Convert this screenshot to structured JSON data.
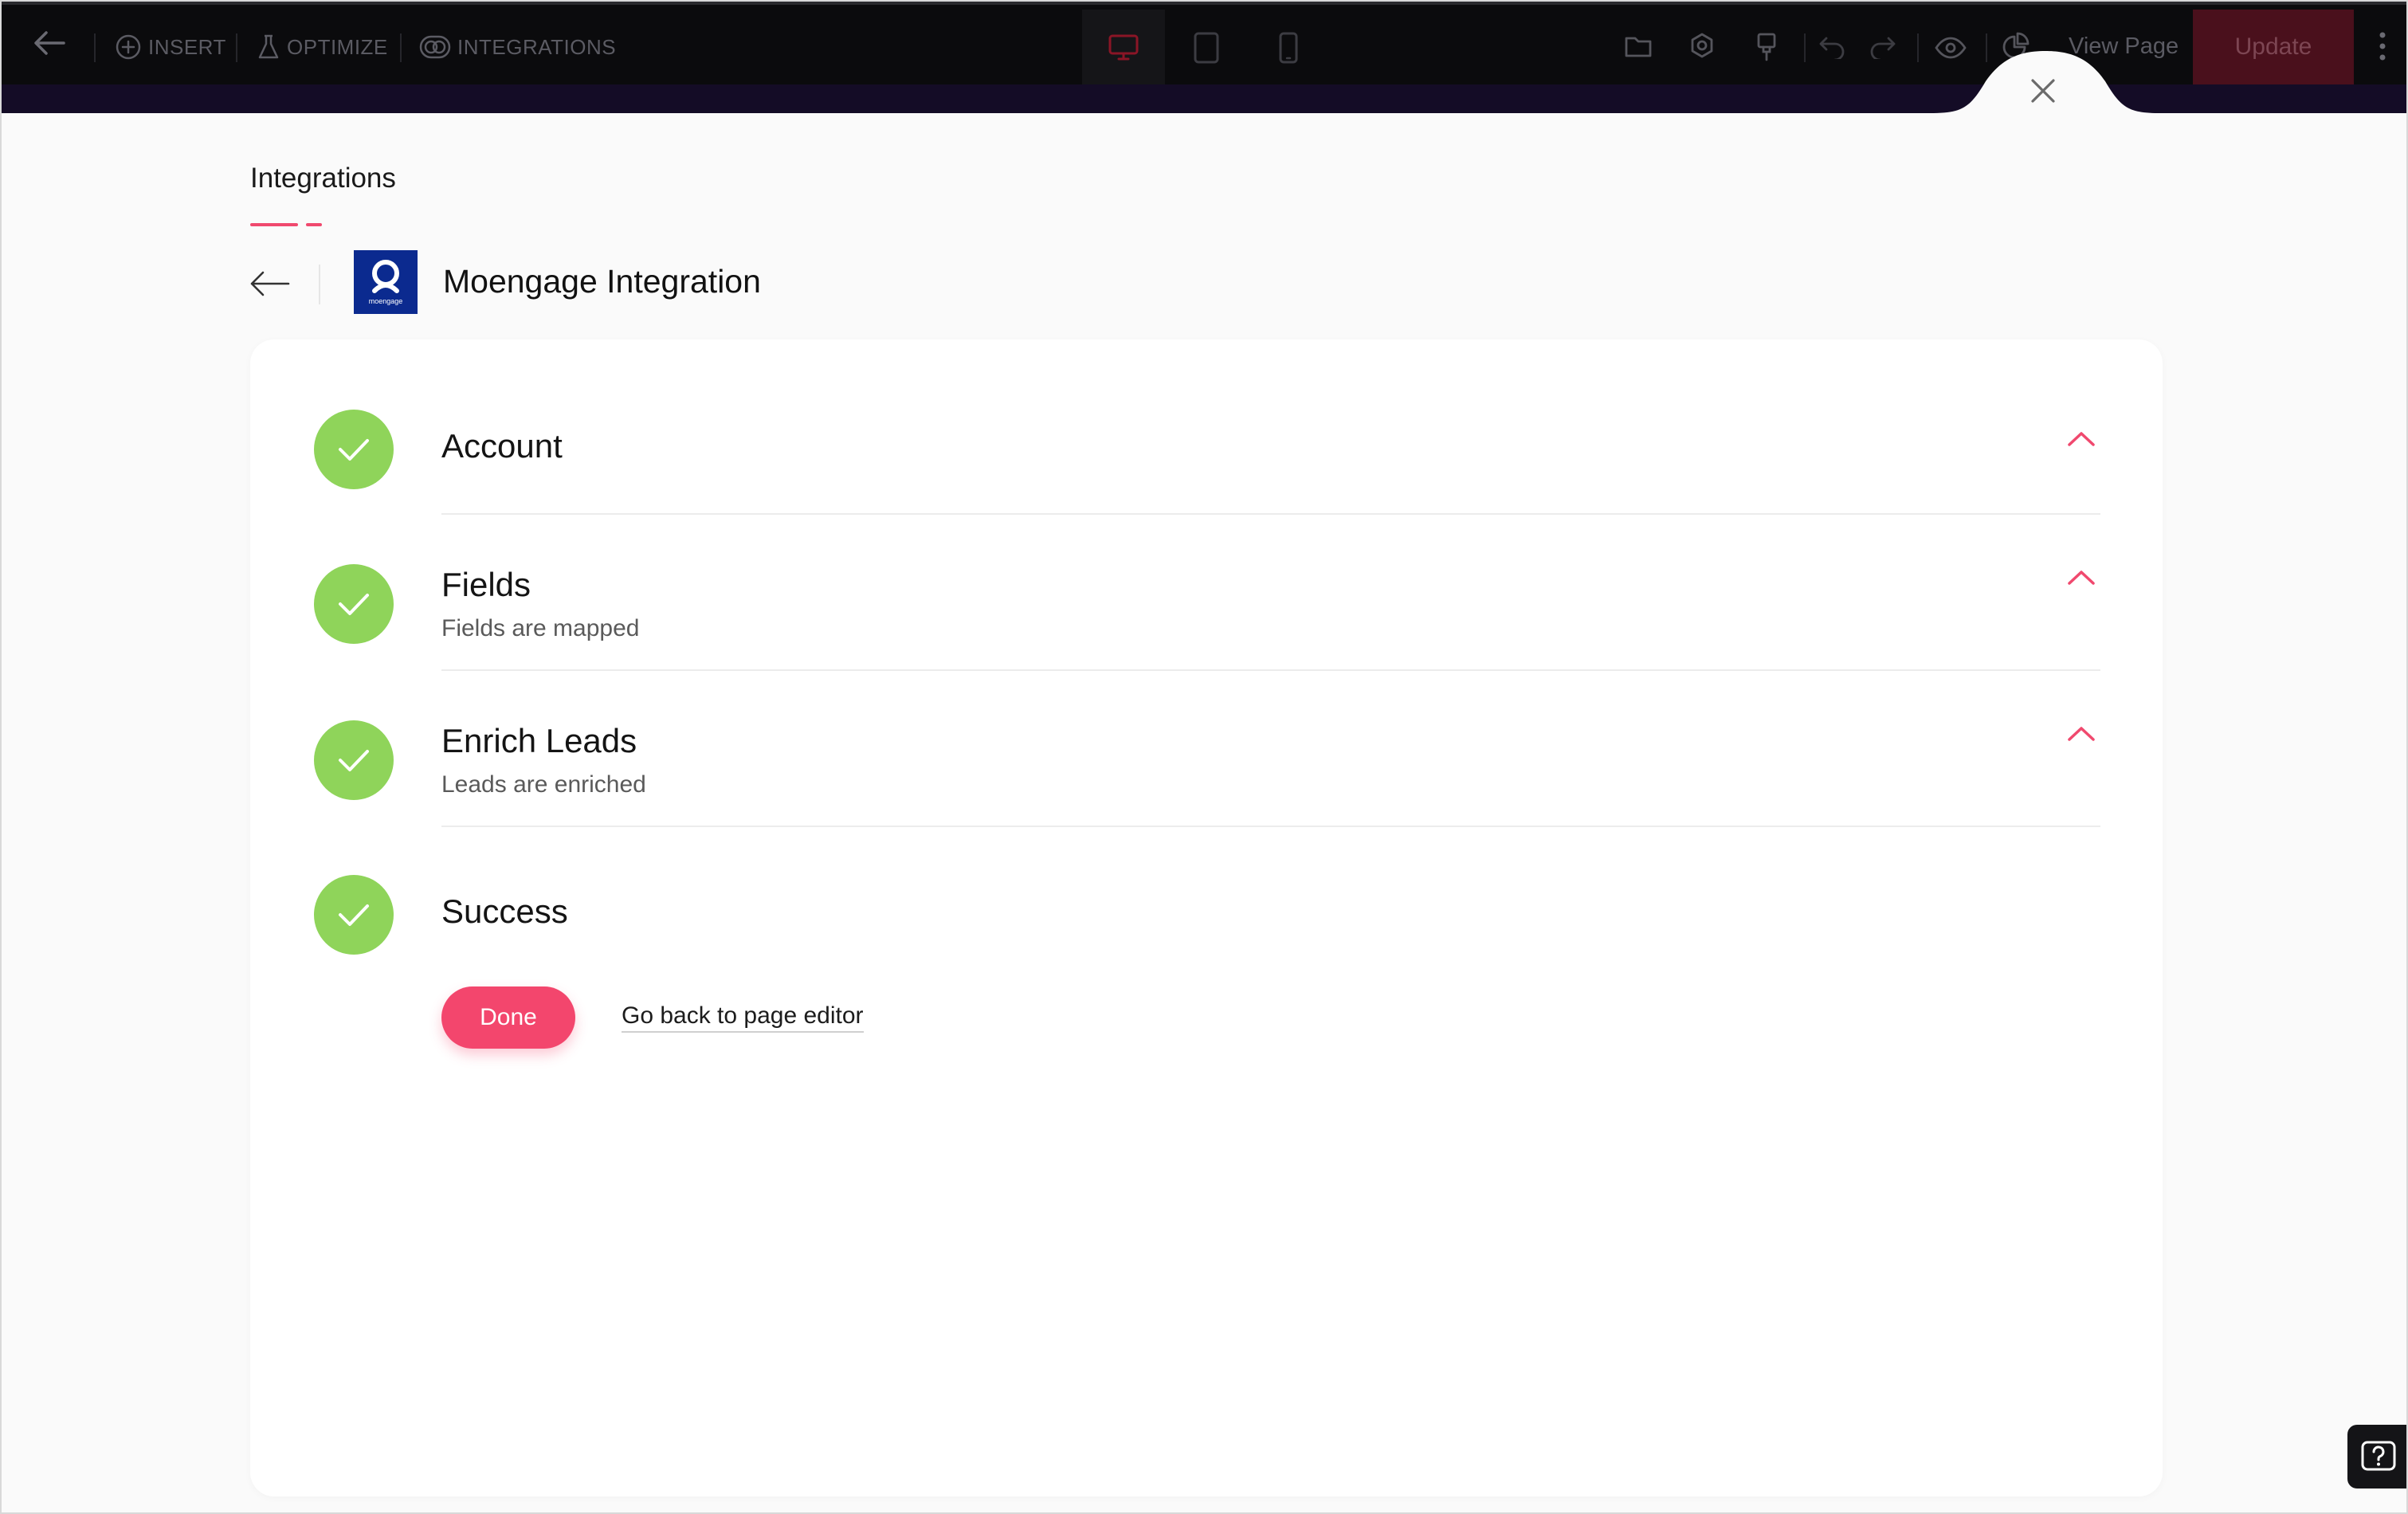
{
  "toolbar": {
    "insert_label": "INSERT",
    "optimize_label": "OPTIMIZE",
    "integrations_label": "INTEGRATIONS",
    "view_page_label": "View Page",
    "update_label": "Update"
  },
  "page": {
    "section_title": "Integrations",
    "integration_title": "Moengage Integration",
    "logo_text": "moengage"
  },
  "steps": [
    {
      "title": "Account",
      "subtitle": ""
    },
    {
      "title": "Fields",
      "subtitle": "Fields are mapped"
    },
    {
      "title": "Enrich Leads",
      "subtitle": "Leads are enriched"
    },
    {
      "title": "Success",
      "subtitle": ""
    }
  ],
  "actions": {
    "done_label": "Done",
    "back_link_label": "Go back to page editor"
  },
  "help": {
    "label": "?"
  },
  "colors": {
    "accent": "#f3466d",
    "success": "#8fd45a",
    "toolbar_bg": "#0b0b0d",
    "brand_logo_bg": "#0b2a8f"
  }
}
